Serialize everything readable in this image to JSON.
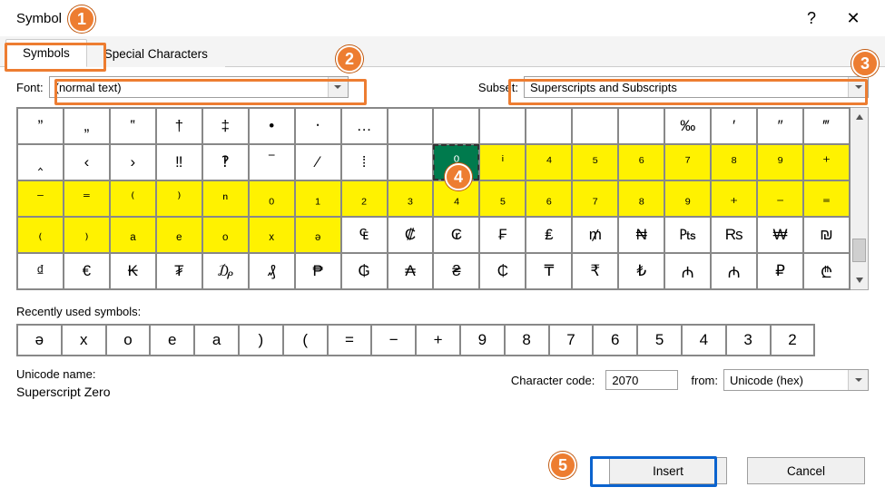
{
  "window": {
    "title": "Symbol",
    "help": "?",
    "close": "✕"
  },
  "tabs": {
    "symbols": "Symbols",
    "special": "Special Characters"
  },
  "labels": {
    "font": "Font:",
    "subset": "Subset:",
    "recent": "Recently used symbols:",
    "unicode_name": "Unicode name:",
    "char_code": "Character code:",
    "from": "from:"
  },
  "combos": {
    "font": "(normal text)",
    "subset": "Superscripts and Subscripts",
    "from": "Unicode (hex)"
  },
  "selected_name": "Superscript Zero",
  "code_value": "2070",
  "buttons": {
    "insert": "Insert",
    "cancel": "Cancel"
  },
  "callouts": [
    "1",
    "2",
    "3",
    "4",
    "5"
  ],
  "grid": {
    "rows": [
      {
        "cells": [
          {
            "g": "”"
          },
          {
            "g": "„"
          },
          {
            "g": "‟"
          },
          {
            "g": "†"
          },
          {
            "g": "‡"
          },
          {
            "g": "•"
          },
          {
            "g": "‧"
          },
          {
            "g": "…"
          },
          {
            "g": " "
          },
          {
            "g": " "
          },
          {
            "g": " "
          },
          {
            "g": " "
          },
          {
            "g": " "
          },
          {
            "g": " "
          },
          {
            "g": "‰"
          },
          {
            "g": "′"
          },
          {
            "g": "″"
          },
          {
            "g": "‴"
          }
        ]
      },
      {
        "cells": [
          {
            "g": "‸"
          },
          {
            "g": "‹"
          },
          {
            "g": "›"
          },
          {
            "g": "‼"
          },
          {
            "g": "‽"
          },
          {
            "g": "‾"
          },
          {
            "g": "⁄"
          },
          {
            "g": "⁞"
          },
          {
            "g": " "
          },
          {
            "g": "⁰",
            "sel": true
          },
          {
            "g": "ⁱ",
            "y": true
          },
          {
            "g": "⁴",
            "y": true
          },
          {
            "g": "⁵",
            "y": true
          },
          {
            "g": "⁶",
            "y": true
          },
          {
            "g": "⁷",
            "y": true
          },
          {
            "g": "⁸",
            "y": true
          },
          {
            "g": "⁹",
            "y": true
          },
          {
            "g": "⁺",
            "y": true
          }
        ]
      },
      {
        "cells": [
          {
            "g": "⁻",
            "y": true
          },
          {
            "g": "⁼",
            "y": true
          },
          {
            "g": "⁽",
            "y": true
          },
          {
            "g": "⁾",
            "y": true
          },
          {
            "g": "ⁿ",
            "y": true
          },
          {
            "g": "₀",
            "y": true
          },
          {
            "g": "₁",
            "y": true
          },
          {
            "g": "₂",
            "y": true
          },
          {
            "g": "₃",
            "y": true
          },
          {
            "g": "₄",
            "y": true
          },
          {
            "g": "₅",
            "y": true
          },
          {
            "g": "₆",
            "y": true
          },
          {
            "g": "₇",
            "y": true
          },
          {
            "g": "₈",
            "y": true
          },
          {
            "g": "₉",
            "y": true
          },
          {
            "g": "₊",
            "y": true
          },
          {
            "g": "₋",
            "y": true
          },
          {
            "g": "₌",
            "y": true
          }
        ]
      },
      {
        "cells": [
          {
            "g": "₍",
            "y": true
          },
          {
            "g": "₎",
            "y": true
          },
          {
            "g": "ₐ",
            "y": true
          },
          {
            "g": "ₑ",
            "y": true
          },
          {
            "g": "ₒ",
            "y": true
          },
          {
            "g": "ₓ",
            "y": true
          },
          {
            "g": "ₔ",
            "y": true
          },
          {
            "g": "₠"
          },
          {
            "g": "₡"
          },
          {
            "g": "₢"
          },
          {
            "g": "₣"
          },
          {
            "g": "₤"
          },
          {
            "g": "₥"
          },
          {
            "g": "₦"
          },
          {
            "g": "₧"
          },
          {
            "g": "₨"
          },
          {
            "g": "₩"
          },
          {
            "g": "₪"
          }
        ]
      },
      {
        "cells": [
          {
            "g": "₫"
          },
          {
            "g": "€"
          },
          {
            "g": "₭"
          },
          {
            "g": "₮"
          },
          {
            "g": "₯"
          },
          {
            "g": "₰"
          },
          {
            "g": "₱"
          },
          {
            "g": "₲"
          },
          {
            "g": "₳"
          },
          {
            "g": "₴"
          },
          {
            "g": "₵"
          },
          {
            "g": "₸"
          },
          {
            "g": "₹"
          },
          {
            "g": "₺"
          },
          {
            "g": "₼"
          },
          {
            "g": "₼"
          },
          {
            "g": "₽"
          },
          {
            "g": "₾"
          }
        ]
      }
    ]
  },
  "recent": [
    "ə",
    "x",
    "o",
    "e",
    "a",
    ")",
    "(",
    "=",
    "−",
    "+",
    "9",
    "8",
    "7",
    "6",
    "5",
    "4",
    "3",
    "2"
  ]
}
